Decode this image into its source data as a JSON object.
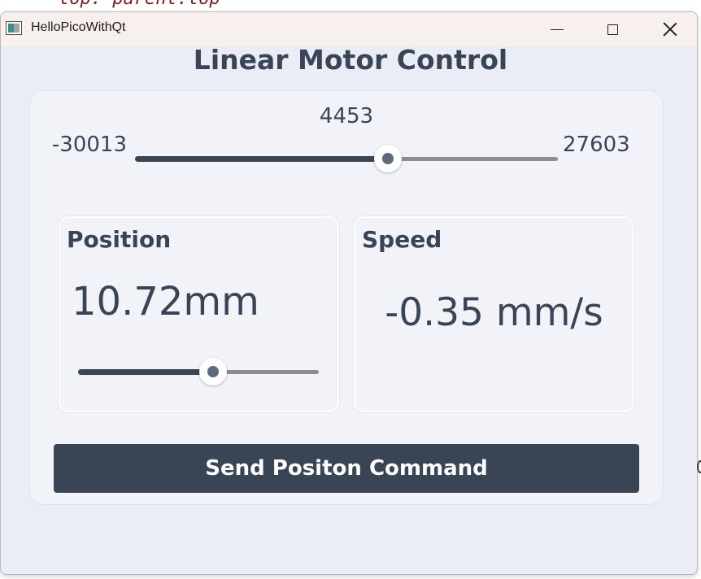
{
  "background": {
    "code_snippet": "top: parent.top"
  },
  "window": {
    "title": "HelloPicoWithQt",
    "icon": "qt-window-icon",
    "controls": {
      "minimize": "minimize-icon",
      "maximize": "maximize-icon",
      "close": "close-icon"
    }
  },
  "app": {
    "heading": "Linear Motor Control",
    "main_slider": {
      "value": 4453,
      "value_label": "4453",
      "min": -30013,
      "min_label": "-30013",
      "max": 27603,
      "max_label": "27603"
    },
    "position_panel": {
      "title": "Position",
      "value": "10.72mm",
      "slider_fraction": 0.56
    },
    "speed_panel": {
      "title": "Speed",
      "value": "-0.35 mm/s"
    },
    "send_button": "Send Positon Command"
  },
  "colors": {
    "accent": "#394555",
    "window_bg": "#eaedf5",
    "card_bg": "#f2f3f8",
    "titlebar_bg": "#f8f0ec",
    "track": "#8b8d90",
    "handle_core": "#5d6a7d"
  }
}
